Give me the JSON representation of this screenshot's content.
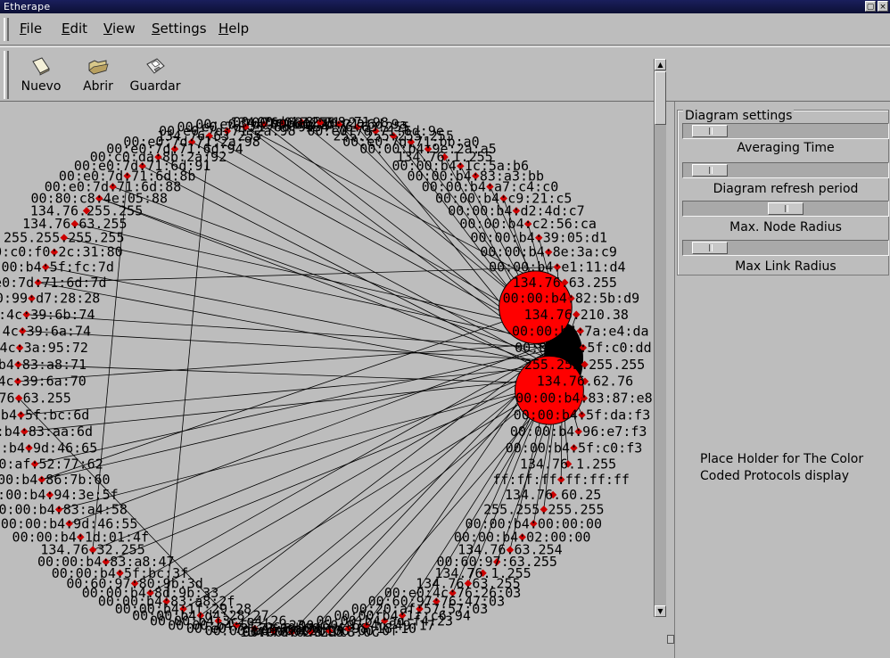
{
  "window": {
    "title": "Etherape"
  },
  "menu": [
    {
      "label": "File",
      "key": "F",
      "rest": "ile"
    },
    {
      "label": "Edit",
      "key": "E",
      "rest": "dit"
    },
    {
      "label": "View",
      "key": "V",
      "rest": "iew"
    },
    {
      "label": "Settings",
      "key": "S",
      "rest": "ettings"
    },
    {
      "label": "Help",
      "key": "H",
      "rest": "elp"
    }
  ],
  "toolbar": [
    {
      "label": "Nuevo",
      "icon": "new-file-icon"
    },
    {
      "label": "Abrir",
      "icon": "open-folder-icon"
    },
    {
      "label": "Guardar",
      "icon": "floppy-disk-icon"
    }
  ],
  "diagram_settings": {
    "title": "Diagram settings",
    "sliders": [
      {
        "label": "Averaging Time",
        "value": 0.05
      },
      {
        "label": "Diagram refresh period",
        "value": 0.05
      },
      {
        "label": "Max. Node Radius",
        "value": 0.5
      },
      {
        "label": "Max Link Radius",
        "value": 0.05
      }
    ]
  },
  "protocols_placeholder": {
    "line1": "Place Holder for The Color",
    "line2": "Coded Protocols display"
  },
  "colors": {
    "node": "#ff0000",
    "node_dot": "#cc0000",
    "link": "#000000",
    "background": "#bdbdbd"
  },
  "nodes": [
    "00:00:b4:83:a8:71",
    "134.76.63.255",
    "00:e0:7d:71:6d:8b",
    "00:e0:7d:71:6d:94",
    "00:e0:7d:71:2a:98",
    "134.76.63.255",
    "00:e0:7d:71:2a:98",
    "00:e0:7d:71:6d:94",
    "00:c0:da:8b:2a:92",
    "00:e0:7d:71:6d:91",
    "00:e0:7d:71:6d:8b",
    "00:e0:7d:71:6d:88",
    "00:80:c8:4e:05:88",
    "134.76.255.255",
    "134.76.63.255",
    "255.255.255.255",
    "00:c0:f0:2c:31:80",
    "00:00:b4:5f:fc:7d",
    "00:e0:7d:71:6d:7d",
    "00:50:99:d7:28:28",
    "00:e0:4c:39:6b:74",
    "00:e0:4c:39:6a:74",
    "00:e0:4c:3a:95:72",
    "00:00:b4:83:a8:71",
    "00:e0:4c:39:6a:70",
    "134.76.63.255",
    "00:00:b4:5f:bc:6d",
    "00:00:b4:83:aa:6d",
    "00:00:b4:9d:46:65",
    "00:20:af:52:77:62",
    "00:00:b4:86:7b:60",
    "00:00:b4:94:3e:5f",
    "00:00:b4:83:a4:58",
    "00:00:b4:9d:46:55",
    "00:00:b4:1d:01:4f",
    "134.76.32.255",
    "00:00:b4:83:a8:47",
    "00:00:b4:5f:bc:3f",
    "00:60:97:80:9b:3d",
    "00:00:b4:8d:9b:33",
    "00:00:b4:83:a8:2f",
    "00:00:b4:1f:29:28",
    "00:00:b4:d4:28:27",
    "00:00:b4:3c:e4:26",
    "00:00:b4:5f:bc:23",
    "00:e0:7d:71:6d:1d",
    "00:00:b4:af:03:17",
    "134.76.63.255",
    "00:00:b4:5f:c8:0c",
    "09:00:2b:00:00:0f",
    "00:00:b4:98:18:10",
    "00:60:97:4d:49:17",
    "00:00:b4:ad:f4:23",
    "00:00:b4:1f:c6:94",
    "00:20:af:57:57:03",
    "00:60:97:76:47:03",
    "00:e0:4c:76:26:03",
    "134.76.63.255",
    "134.76.1.255",
    "00:60:97:63.255",
    "134.76.63.254",
    "00:00:b4:02:00:00",
    "00:00:b4:00:00:00",
    "255.255.255.255",
    "134.76.60.25",
    "ff:ff:ff:ff:ff:ff",
    "134.76.1.255",
    "00:00:b4:5f:c0:f3",
    "00:00:b4:96:e7:f3",
    "00:00:b4:5f:da:f3",
    "00:00:b4:83:87:e8",
    "134.76.62.76",
    "255.255.255.255",
    "00:00:b4:5f:c0:dd",
    "00:00:b4:7a:e4:da",
    "134.76.210.38",
    "00:00:b4:82:5b:d9",
    "134.76.63.255",
    "00:00:b4:e1:11:d4",
    "00:00:b4:8e:3a:c9",
    "00:00:b4:39:05:d1",
    "00:00:b4:c2:56:ca",
    "00:00:b4:d2:4d:c7",
    "00:00:b4:c9:21:c5",
    "00:00:b4:a7:c4:c0",
    "00:00:b4:83:a3:bb",
    "00:00:b4:1c:5a:b6",
    "134.76.1.255",
    "00:00:b4:9e:2a:a5",
    "00:e0:7d:71:bb:a0",
    "255.255.255.255",
    "00:e0:7d:71:6d:9e",
    "134.76.63.255",
    "00:e0:7d:21:6d:9a",
    "00:e0:7d:71:2a:98"
  ],
  "big_nodes": [
    {
      "label": "134.76.63.255",
      "node": 76,
      "r": 0.85
    },
    {
      "label": "134.76.62.76",
      "node": 71,
      "r": 0.8
    }
  ]
}
